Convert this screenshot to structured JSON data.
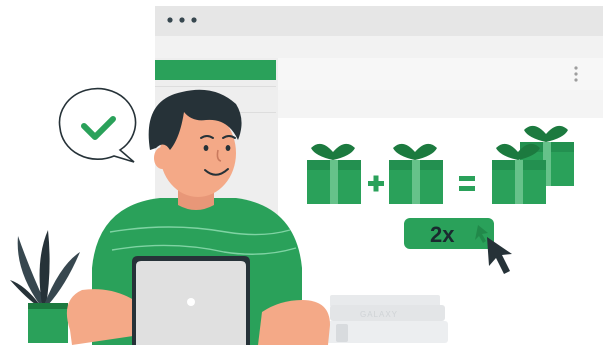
{
  "illustration": {
    "button": {
      "label": "2x"
    },
    "book": {
      "spine_label": "GALAXY"
    },
    "colors": {
      "accent": "#2aa15a",
      "accent_dark": "#1c7a3f",
      "skin": "#f4a987",
      "hair": "#263238",
      "window_frame": "#e6e6e6",
      "window_body": "#f5f5f5",
      "laptop": "#e0e0e0",
      "book": "#e3e5e7"
    },
    "icons": [
      "checkmark-icon",
      "gift-icon",
      "plus-icon",
      "equals-icon",
      "cursor-icon",
      "window-dots-icon",
      "kebab-menu-icon"
    ]
  }
}
